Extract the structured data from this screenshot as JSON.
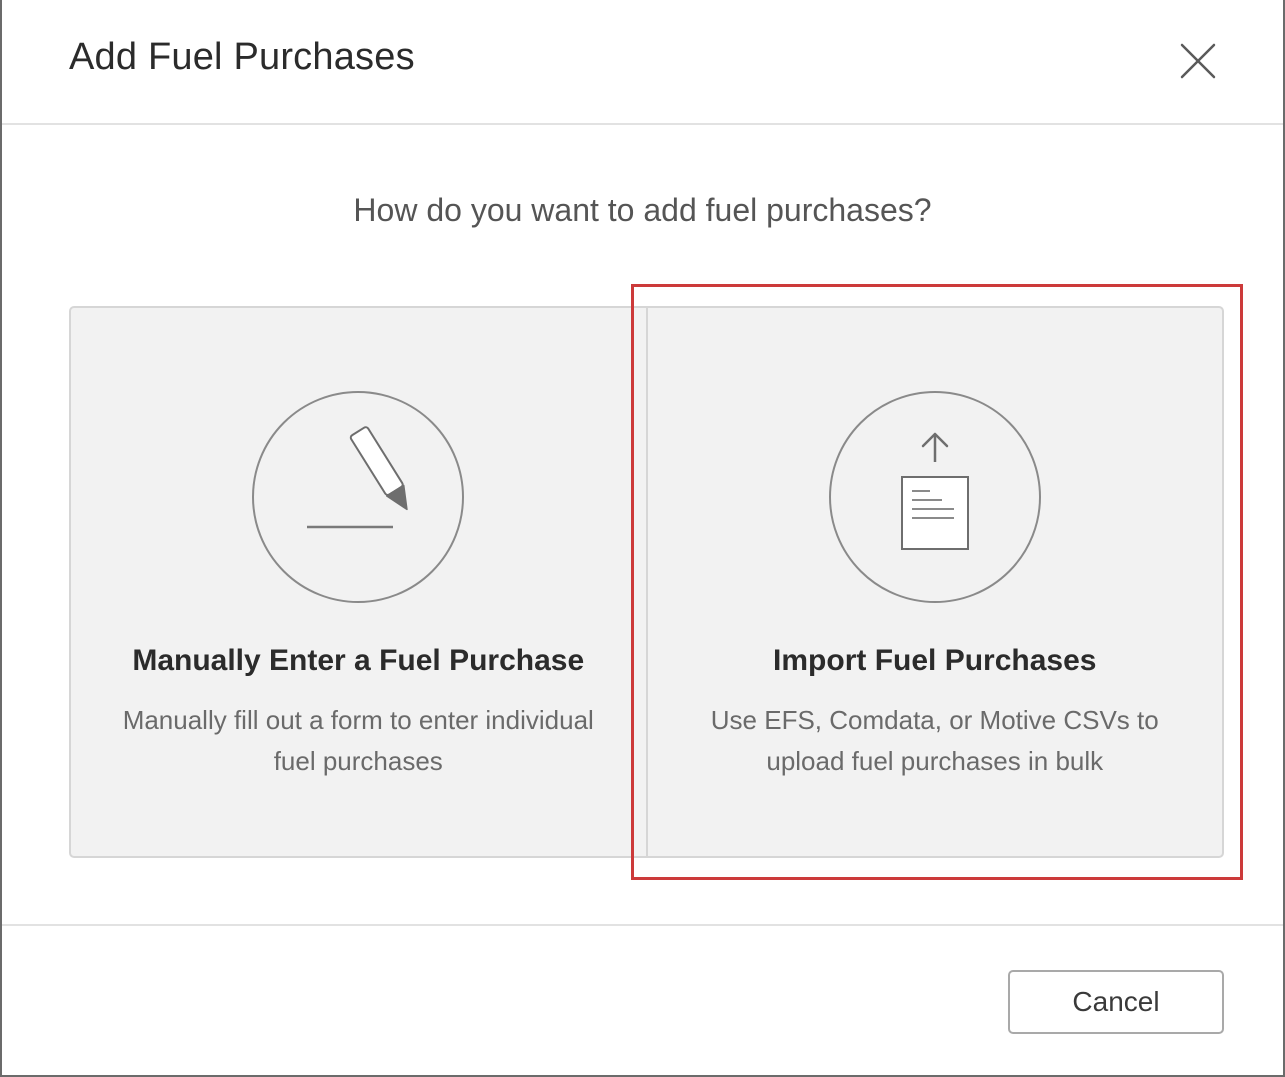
{
  "dialog": {
    "title": "Add Fuel Purchases",
    "close_icon": "close-icon"
  },
  "prompt": "How do you want to add fuel purchases?",
  "options": [
    {
      "icon": "pencil-icon",
      "title": "Manually Enter a Fuel Purchase",
      "description": "Manually fill out a form to enter individual fuel purchases"
    },
    {
      "icon": "upload-document-icon",
      "title": "Import Fuel Purchases",
      "description": "Use EFS, Comdata, or Motive CSVs to upload fuel purchases in bulk"
    }
  ],
  "highlight": {
    "target": "option-import",
    "color": "#cc3a3a"
  },
  "footer": {
    "cancel_label": "Cancel"
  }
}
